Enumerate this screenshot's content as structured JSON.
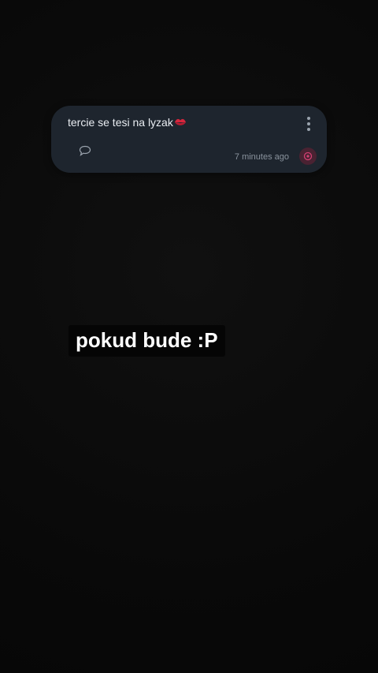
{
  "note": {
    "text": "tercie se tesi na lyzak",
    "emoji_icon": "kiss-mark-icon",
    "timestamp": "7 minutes ago",
    "menu_icon": "more-vertical-icon",
    "comment_icon": "comment-bubble-icon",
    "react_icon": "reaction-icon"
  },
  "caption": {
    "text": "pokud bude :P"
  },
  "colors": {
    "background": "#0b0b0b",
    "card": "#1e252e",
    "card_text": "#e9edf2",
    "muted_text": "#8a939d",
    "reaction_bg": "#4a2232",
    "reaction_accent": "#d23f72",
    "kiss_red": "#d7263d"
  }
}
